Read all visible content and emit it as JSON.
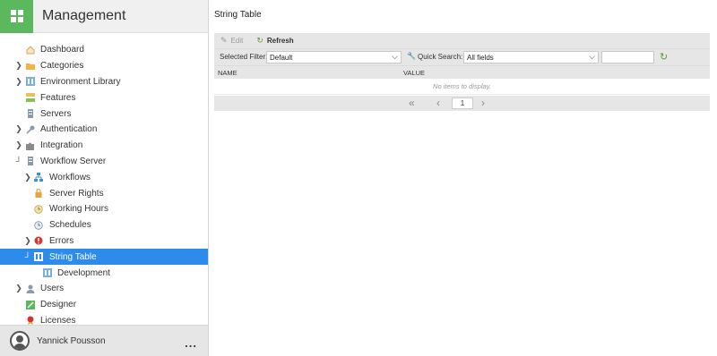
{
  "app": {
    "title": "Management"
  },
  "nav": [
    {
      "label": "Dashboard",
      "icon": "dashboard-icon",
      "toggle": ""
    },
    {
      "label": "Categories",
      "icon": "folder-icon",
      "toggle": "expand"
    },
    {
      "label": "Environment Library",
      "icon": "library-icon",
      "toggle": "expand"
    },
    {
      "label": "Features",
      "icon": "features-icon",
      "toggle": ""
    },
    {
      "label": "Servers",
      "icon": "server-icon",
      "toggle": ""
    },
    {
      "label": "Authentication",
      "icon": "key-icon",
      "toggle": "expand"
    },
    {
      "label": "Integration",
      "icon": "puzzle-icon",
      "toggle": "expand"
    },
    {
      "label": "Workflow Server",
      "icon": "server-icon",
      "toggle": "collapse"
    },
    {
      "label": "Workflows",
      "icon": "workflow-icon",
      "toggle": "expand"
    },
    {
      "label": "Server Rights",
      "icon": "lock-icon",
      "toggle": ""
    },
    {
      "label": "Working Hours",
      "icon": "clock-icon",
      "toggle": ""
    },
    {
      "label": "Schedules",
      "icon": "schedule-icon",
      "toggle": ""
    },
    {
      "label": "Errors",
      "icon": "error-icon",
      "toggle": "expand"
    },
    {
      "label": "String Table",
      "icon": "string-table-icon",
      "toggle": "collapse"
    },
    {
      "label": "Development",
      "icon": "library-icon",
      "toggle": ""
    },
    {
      "label": "Users",
      "icon": "user-icon",
      "toggle": "expand"
    },
    {
      "label": "Designer",
      "icon": "designer-icon",
      "toggle": ""
    },
    {
      "label": "Licenses",
      "icon": "license-icon",
      "toggle": ""
    }
  ],
  "user": {
    "name": "Yannick Pousson",
    "more": "..."
  },
  "page": {
    "title": "String Table"
  },
  "toolbar": {
    "edit_label": "Edit",
    "refresh_label": "Refresh"
  },
  "filters": {
    "selected_filter_label": "Selected Filter:",
    "selected_filter_value": "Default",
    "quick_search_label": "Quick Search:",
    "quick_search_value": "All fields",
    "search_text": ""
  },
  "table": {
    "columns": [
      "NAME",
      "VALUE"
    ],
    "empty_text": "No items to display."
  },
  "pager": {
    "page": "1"
  },
  "colors": {
    "accent": "#2d8ceb",
    "brand": "#5cb85c",
    "refresh": "#5aa02c"
  }
}
